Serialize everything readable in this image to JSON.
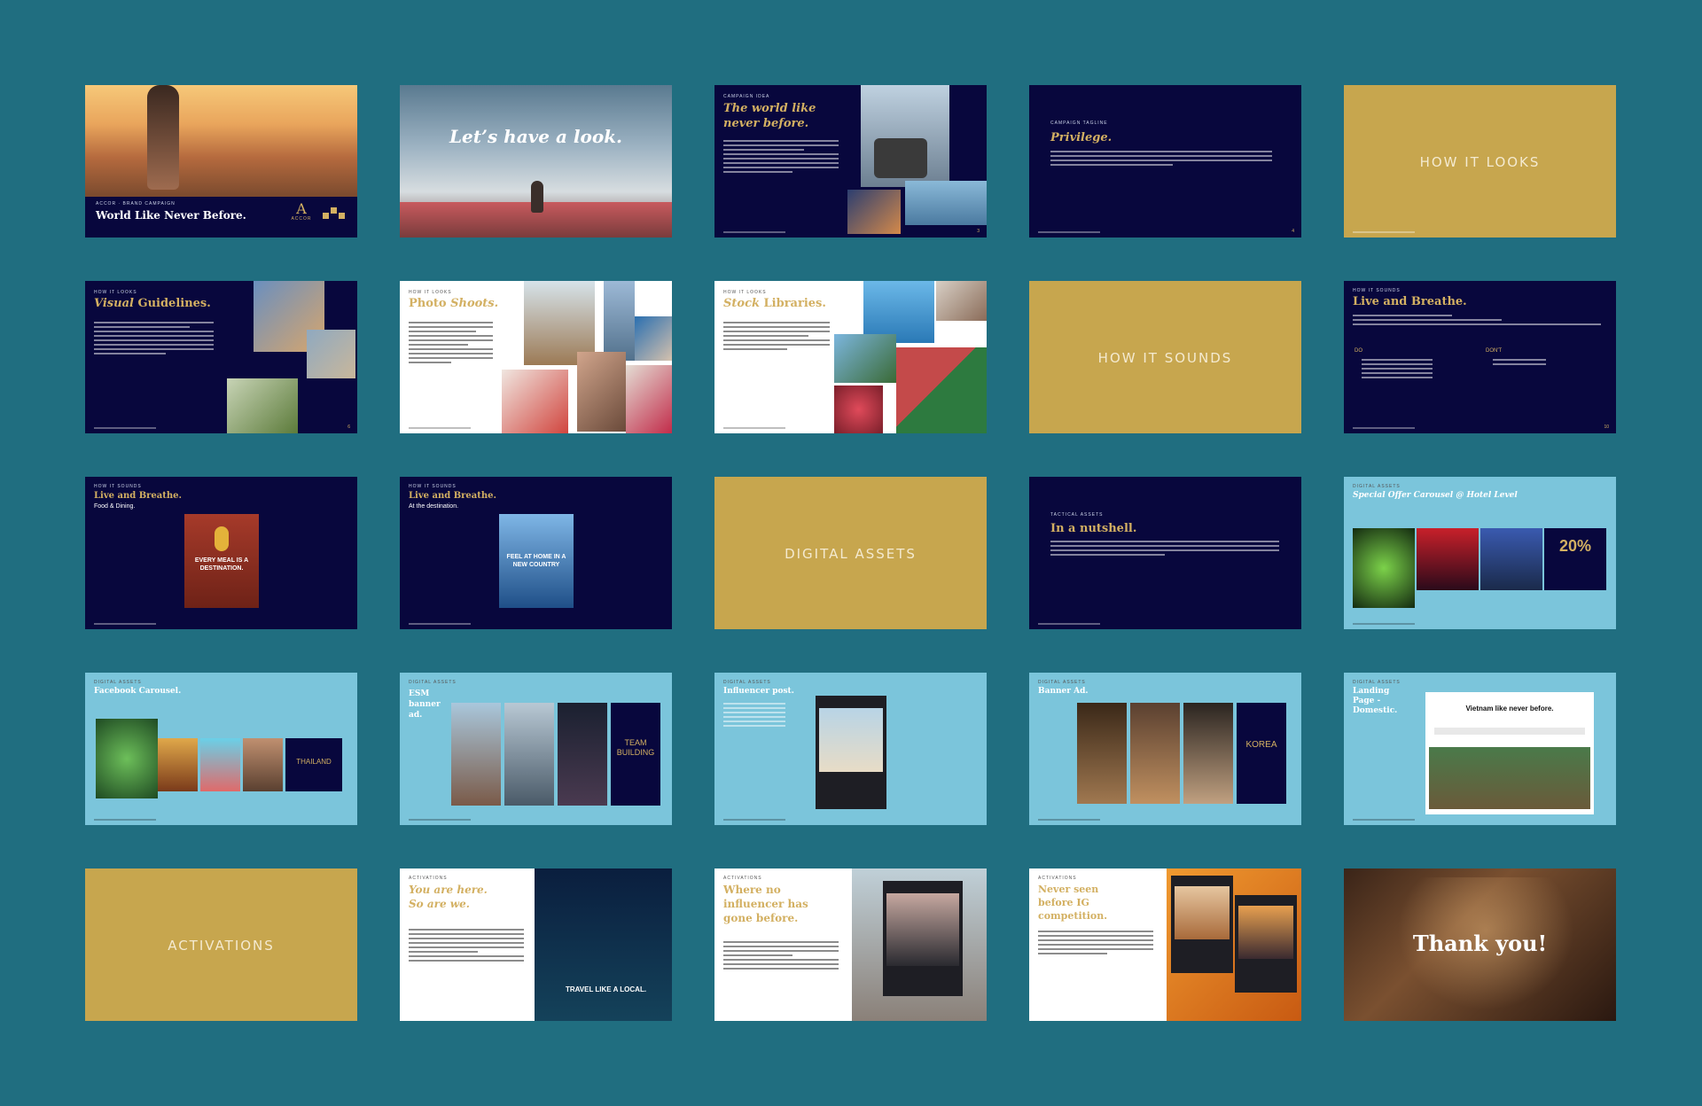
{
  "slides": {
    "s1": {
      "title": "World Like Never Before.",
      "kicker": "ACCOR · BRAND CAMPAIGN",
      "logo": "ACCOR"
    },
    "s2": {
      "title": "Let’s have a look."
    },
    "s3": {
      "title": "The world like never before."
    },
    "s4": {
      "title": "Privilege."
    },
    "s5": {
      "title": "HOW IT LOOKS"
    },
    "s6": {
      "title_em": "Visual",
      "title_rest": " Guidelines."
    },
    "s7": {
      "title_em": "Photo",
      "title_rest": " Shoots."
    },
    "s8": {
      "title_em": "Stock",
      "title_rest": " Libraries."
    },
    "s9": {
      "title": "HOW IT SOUNDS"
    },
    "s10": {
      "title": "Live and Breathe.",
      "col1_label": "DO",
      "col2_label": "DON'T"
    },
    "s11": {
      "title": "Live and Breathe.",
      "subtitle": "Food & Dining.",
      "poster_text": "EVERY MEAL IS A DESTINATION."
    },
    "s12": {
      "title": "Live and Breathe.",
      "subtitle": "At the destination.",
      "poster_text": "FEEL AT HOME IN A NEW COUNTRY"
    },
    "s13": {
      "title": "DIGITAL ASSETS"
    },
    "s14": {
      "title": "In a nutshell.",
      "kicker": "TACTICAL ASSETS"
    },
    "s15": {
      "title": "Special Offer Carousel @ Hotel Level",
      "badge": "20%"
    },
    "s16": {
      "title": "Facebook Carousel.",
      "card_text": "THAILAND"
    },
    "s17": {
      "title": "ESM banner ad.",
      "card_text": "TEAM BUILDING"
    },
    "s18": {
      "title": "Influencer post."
    },
    "s19": {
      "title": "Banner Ad.",
      "card_text": "KOREA"
    },
    "s20": {
      "title": "Landing Page - Domestic.",
      "headline": "Vietnam like never before."
    },
    "s21": {
      "title": "ACTIVATIONS"
    },
    "s22": {
      "title": "You are here. So are we.",
      "image_text": "TRAVEL LIKE A LOCAL."
    },
    "s23": {
      "title": "Where no influencer has gone before."
    },
    "s24": {
      "title": "Never seen before IG competition."
    },
    "s25": {
      "title": "Thank you!"
    }
  },
  "colors": {
    "background": "#206e80",
    "navy": "#08073d",
    "gold": "#c7a64e",
    "light_blue": "#7bc5db",
    "accent_gold": "#d3b062"
  }
}
